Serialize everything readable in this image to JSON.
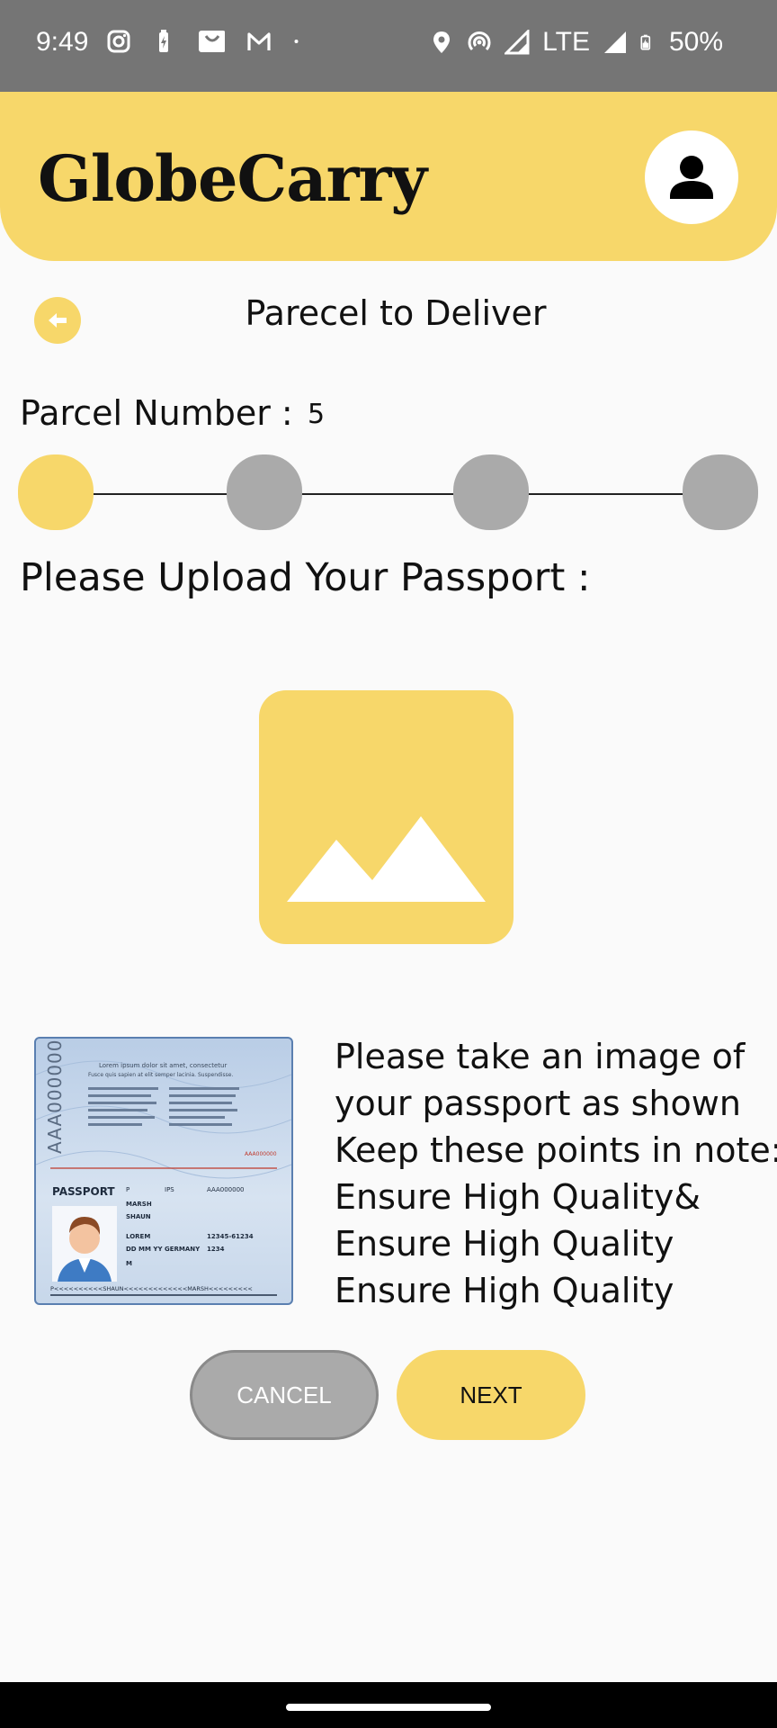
{
  "status_bar": {
    "time": "9:49",
    "network": "LTE",
    "battery": "50%",
    "left_icons": [
      "instagram-icon",
      "battery-saver-icon",
      "shopping-bag-icon",
      "gmail-icon",
      "dot-icon"
    ],
    "right_icons": [
      "location-icon",
      "hotspot-icon",
      "signal-icon",
      "signal-icon",
      "battery-charging-icon"
    ]
  },
  "header": {
    "app_title": "GlobeCarry",
    "profile_icon": "person-icon",
    "color": "#f7d76a"
  },
  "page": {
    "heading": "Parecel to Deliver",
    "back_icon": "arrow-left-icon"
  },
  "parcel": {
    "label": "Parcel Number :",
    "value": "5"
  },
  "stepper": {
    "steps": 4,
    "current_step": 1,
    "active_color": "#f7d76a",
    "inactive_color": "#aaaaaa"
  },
  "upload": {
    "heading": "Please Upload Your Passport :",
    "icon": "image-placeholder-icon"
  },
  "passport_sample": {
    "code": "AAA000000",
    "title": "PASSPORT",
    "name": "SHAUN",
    "surname": "MARSH",
    "country": "GERMANY",
    "number": "AAA000000",
    "phone": "12345-61234",
    "code2": "1234",
    "type": "P",
    "issuer": "IPS",
    "sex": "M",
    "birth": "LOREM",
    "dates": "DD MM YY",
    "intro": "Lorem ipsum dolor sit amet, consectetur",
    "intro2": "Fusce quis sapien at elit semper lacinia. Suspendisse.",
    "mrz": "P<<<<<<<<<<SHAUN<<<<<<<<<<<<<MARSH<<<<<<<<<"
  },
  "instructions": [
    "Please take an image of",
    "your passport as shown",
    "Keep these points in note:",
    "Ensure High Quality&",
    "Ensure High Quality",
    "Ensure High Quality"
  ],
  "buttons": {
    "cancel": "CANCEL",
    "next": "NEXT"
  }
}
